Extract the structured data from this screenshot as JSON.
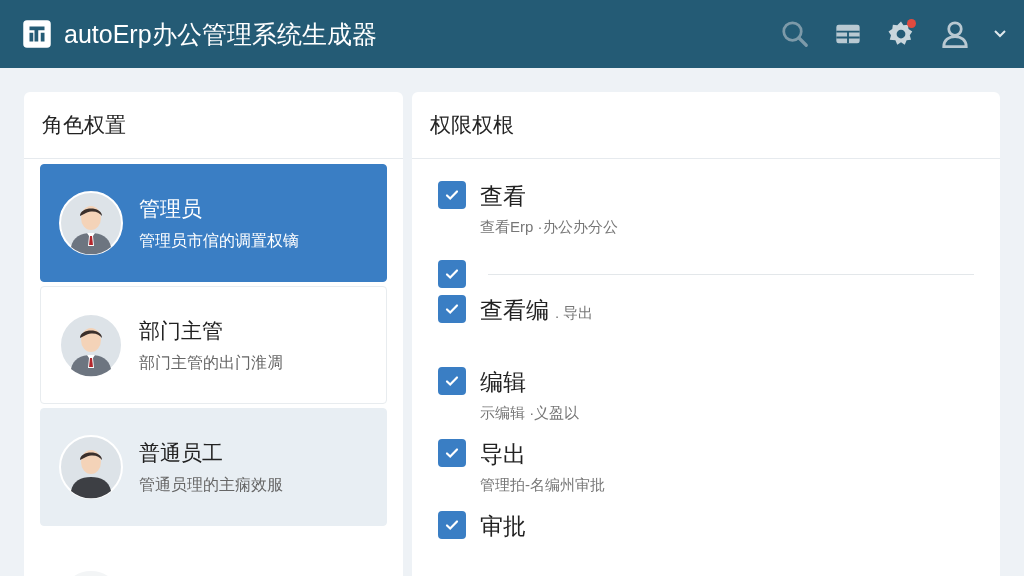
{
  "app": {
    "title": "autoErp办公管理系统生成器",
    "notification": true
  },
  "roles_panel": {
    "title": "角色权置",
    "roles": [
      {
        "kind": "suit",
        "name": "管理员",
        "description": "管理员市倌的调置权镝",
        "selected": true,
        "highlighted": false
      },
      {
        "kind": "suit",
        "name": "部门主管",
        "description": "部门主管的出门淮凋",
        "selected": false,
        "highlighted": false
      },
      {
        "kind": "tee",
        "name": "普通员工",
        "description": "管通员理的主痫效服",
        "selected": false,
        "highlighted": true
      },
      {
        "kind": "partial"
      }
    ]
  },
  "permissions_panel": {
    "title": "权限权根",
    "permissions": [
      {
        "kind": "item",
        "label": "查看",
        "description": "查看Erp ·办公办分公",
        "checked": true
      },
      {
        "kind": "divider",
        "checked": true
      },
      {
        "kind": "item",
        "label": "查看编",
        "note": ". 导出",
        "checked": true
      },
      {
        "kind": "item",
        "label": "编辑",
        "description": "示编辑 ·义盈以",
        "checked": true
      },
      {
        "kind": "item",
        "label": "导出",
        "description": "管理拍-名编州审批",
        "checked": true
      },
      {
        "kind": "item",
        "label": "审批",
        "checked": true
      }
    ]
  }
}
